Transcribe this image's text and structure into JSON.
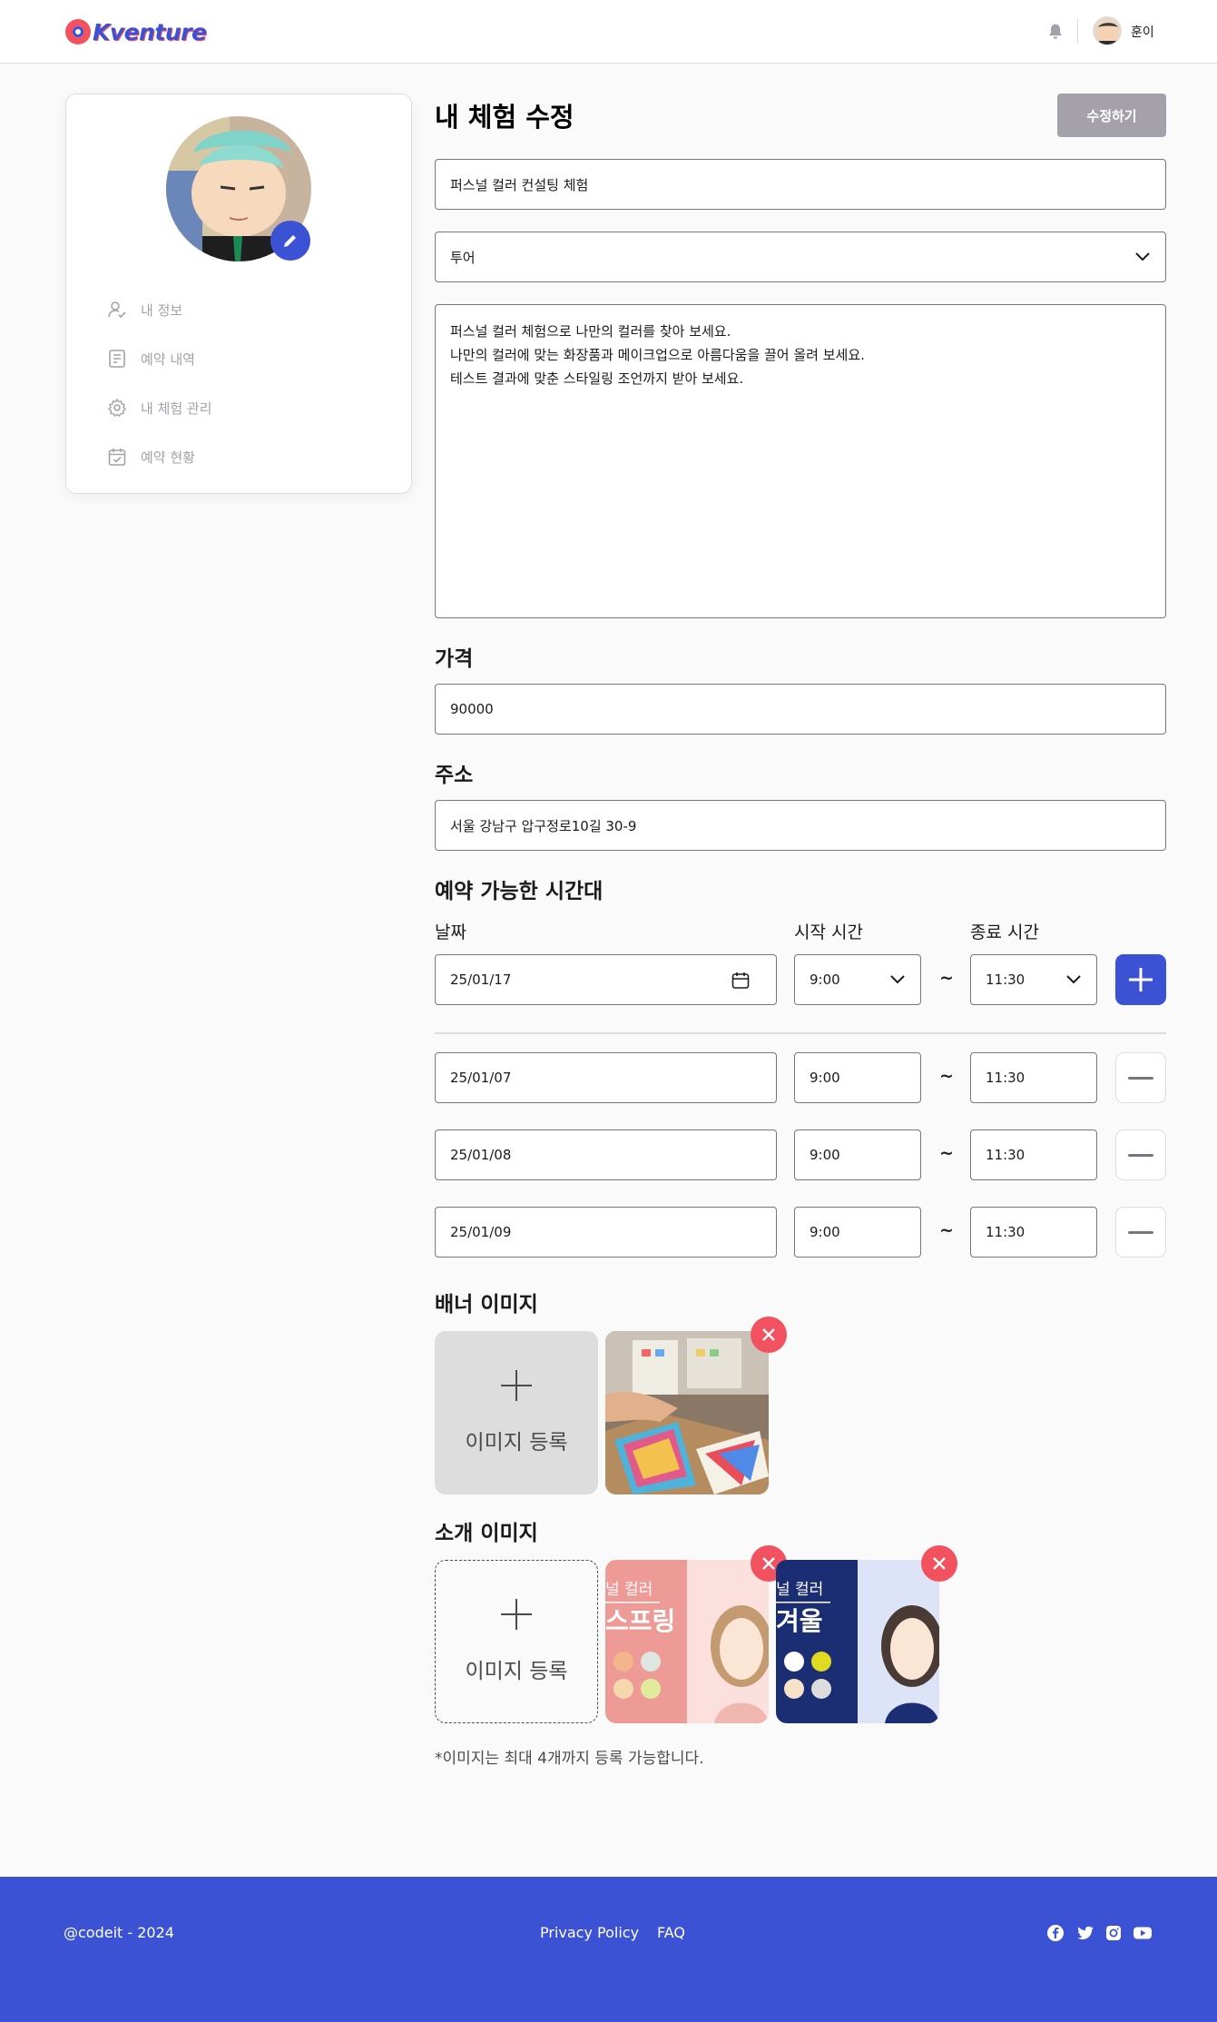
{
  "header": {
    "logo_text": "Kventure",
    "user_name": "훈이"
  },
  "sidebar": {
    "items": [
      {
        "label": "내 정보",
        "icon": "user-check-icon"
      },
      {
        "label": "예약 내역",
        "icon": "list-document-icon"
      },
      {
        "label": "내 체험 관리",
        "icon": "gear-icon"
      },
      {
        "label": "예약 현황",
        "icon": "calendar-check-icon"
      }
    ]
  },
  "main": {
    "title": "내 체험 수정",
    "submit_label": "수정하기",
    "title_value": "퍼스널 컬러 컨설팅 체험",
    "category_value": "투어",
    "description_lines": [
      "퍼스널 컬러 체험으로 나만의 컬러를 찾아 보세요.",
      "나만의 컬러에 맞는 화장품과 메이크업으로 아름다움을 끌어 올려 보세요.",
      "테스트 결과에 맞춘 스타일링 조언까지 받아 보세요."
    ],
    "price_label": "가격",
    "price_value": "90000",
    "address_label": "주소",
    "address_value": "서울 강남구 압구정로10길 30-9"
  },
  "schedule": {
    "title": "예약 가능한 시간대",
    "date_label": "날짜",
    "start_label": "시작 시간",
    "end_label": "종료 시간",
    "separator": "~",
    "input_row": {
      "date": "25/01/17",
      "start": "9:00",
      "end": "11:30"
    },
    "rows": [
      {
        "date": "25/01/07",
        "start": "9:00",
        "end": "11:30"
      },
      {
        "date": "25/01/08",
        "start": "9:00",
        "end": "11:30"
      },
      {
        "date": "25/01/09",
        "start": "9:00",
        "end": "11:30"
      }
    ]
  },
  "banner": {
    "title": "배너 이미지",
    "add_label": "이미지 등록"
  },
  "intro": {
    "title": "소개 이미지",
    "add_label": "이미지 등록",
    "images": [
      {
        "caption_top": "널 컬러",
        "caption_main": "스프링"
      },
      {
        "caption_top": "널 컬러",
        "caption_main": "겨울"
      }
    ]
  },
  "note": "*이미지는 최대 4개까지 등록 가능합니다.",
  "footer": {
    "copyright": "@codeit - 2024",
    "privacy": "Privacy Policy",
    "faq": "FAQ"
  },
  "colors": {
    "brand": "#3b52d4",
    "accent_red": "#f2525f",
    "disabled_button": "#a4a1aa"
  }
}
